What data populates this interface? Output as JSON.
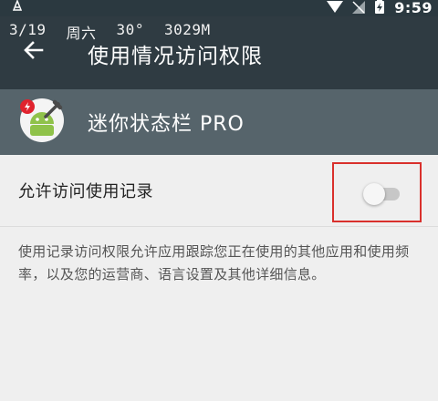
{
  "status_bar": {
    "time": "9:59",
    "icons": [
      "notification-icon",
      "wifi-icon",
      "no-sim-icon",
      "battery-icon"
    ]
  },
  "overlay": {
    "date": "3/19",
    "weekday": "周六",
    "temperature": "30°",
    "memory": "3029M"
  },
  "toolbar": {
    "title": "使用情况访问权限",
    "back_icon": "arrow-back-icon"
  },
  "app": {
    "name": "迷你状态栏 PRO",
    "icon": "android-robot-icon"
  },
  "setting": {
    "label": "允许访问使用记录",
    "toggle_state": "off"
  },
  "description": "使用记录访问权限允许应用跟踪您正在使用的其他应用和使用频率，以及您的运营商、语言设置及其他详细信息。",
  "colors": {
    "toolbar_bg": "#2f3b42",
    "app_header_bg": "#56646b",
    "page_bg": "#efefef",
    "highlight_border": "#d9302c"
  }
}
